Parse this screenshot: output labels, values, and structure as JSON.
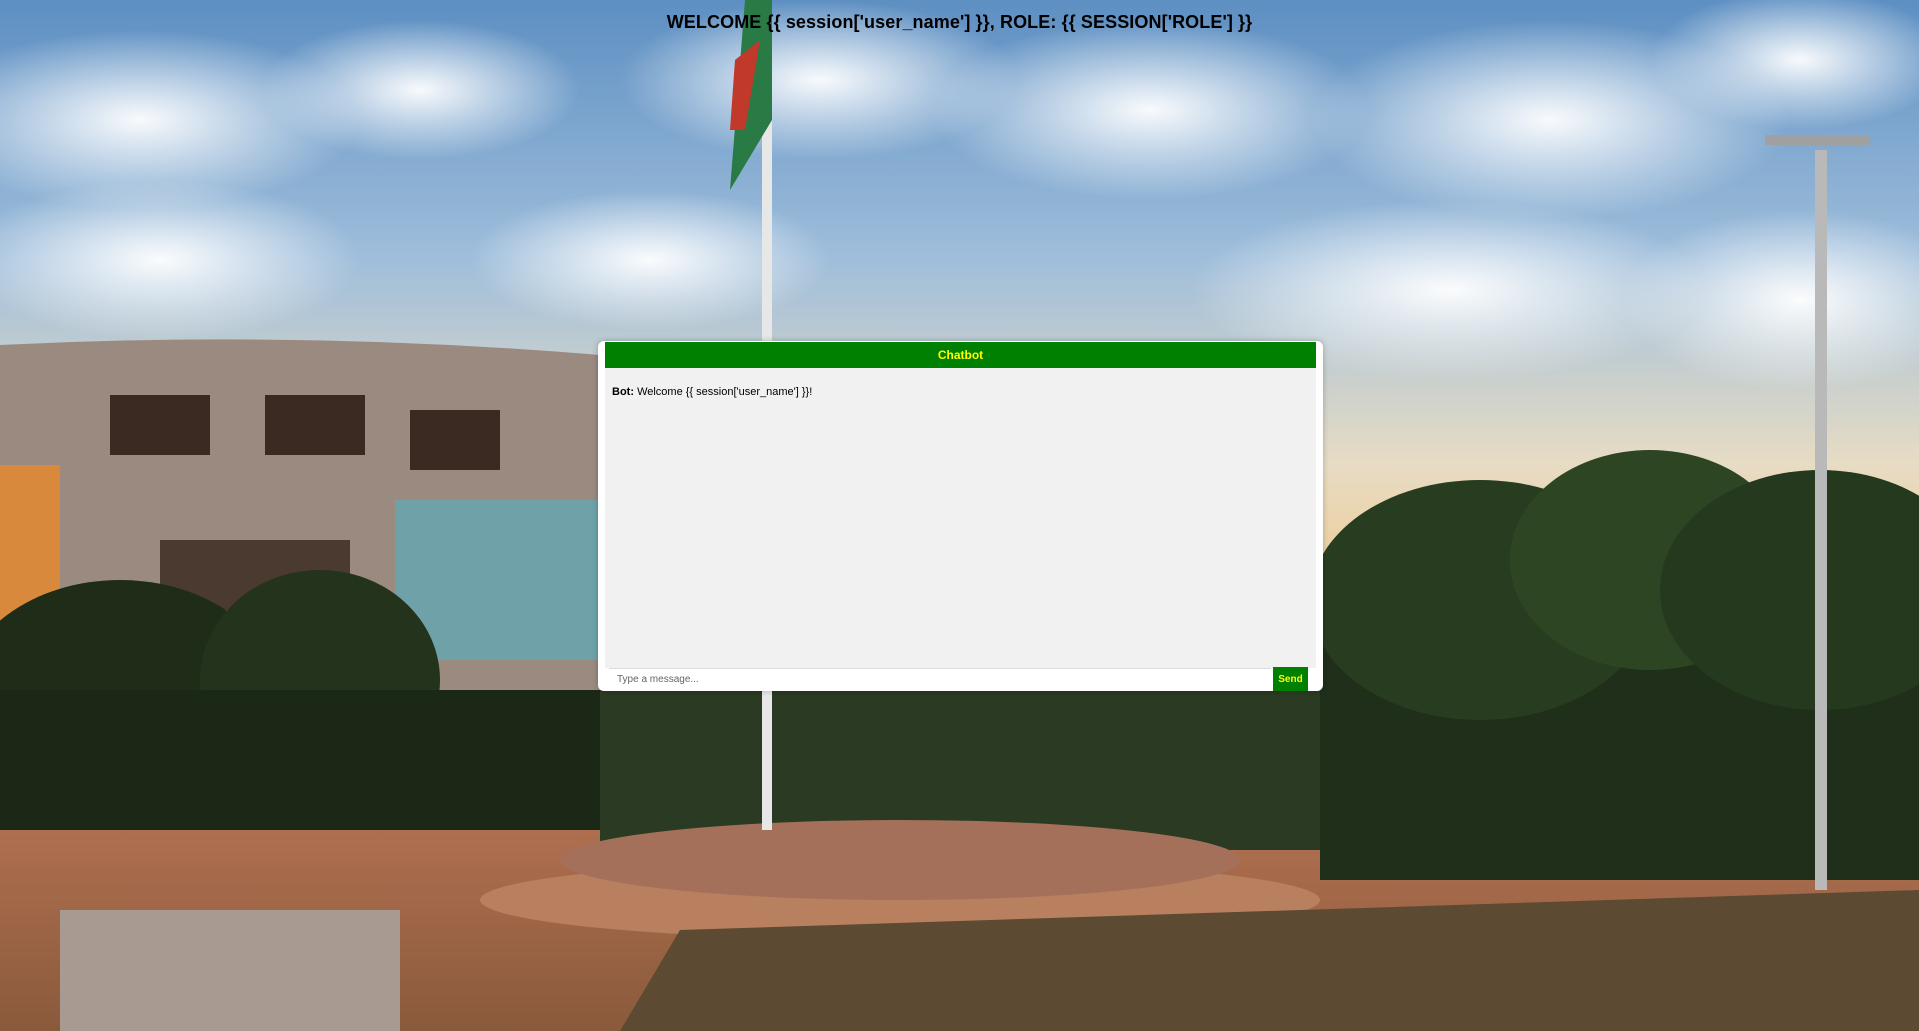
{
  "page": {
    "welcome": "WELCOME {{ session['user_name'] }}, ROLE: {{ SESSION['ROLE'] }}"
  },
  "chat": {
    "title": "Chatbot",
    "messages": [
      {
        "sender": "Bot:",
        "text": "Welcome {{ session['user_name'] }}!"
      }
    ],
    "input_placeholder": "Type a message...",
    "input_value": "",
    "send_label": "Send"
  },
  "colors": {
    "accent": "#008000",
    "accent_text": "#ffff00",
    "log_bg": "#f1f1f1"
  },
  "background": {
    "description_icon": "campus-photo-background"
  }
}
